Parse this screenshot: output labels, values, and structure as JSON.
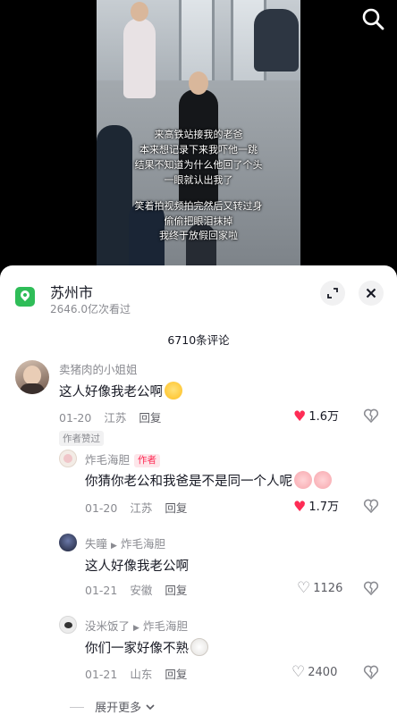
{
  "video": {
    "caption_lines": [
      "来高铁站接我的老爸",
      "本来想记录下来我吓他一跳",
      "结果不知道为什么他回了个头",
      "一眼就认出我了",
      "",
      "笑着拍视频拍完然后又转过身",
      "偷偷把眼泪抹掉",
      "我终于放假回家啦"
    ]
  },
  "location": {
    "name": "苏州市",
    "views": "2646.0亿次看过"
  },
  "comments_header": {
    "count": "6710条评论"
  },
  "comments": [
    {
      "user": "卖猪肉的小姐姐",
      "text": "这人好像我老公啊",
      "date": "01-20",
      "region": "江苏",
      "reply_label": "回复",
      "likes": "1.6万",
      "liked": true,
      "badge": "作者赞过"
    }
  ],
  "replies": [
    {
      "user": "炸毛海胆",
      "author_badge": "作者",
      "text": "你猜你老公和我爸是不是同一个人呢",
      "date": "01-20",
      "region": "江苏",
      "reply_label": "回复",
      "likes": "1.7万",
      "liked": true
    },
    {
      "user": "失瞳",
      "reply_to": "炸毛海胆",
      "text": "这人好像我老公啊",
      "date": "01-21",
      "region": "安徽",
      "reply_label": "回复",
      "likes": "1126",
      "liked": false
    },
    {
      "user": "没米饭了",
      "reply_to": "炸毛海胆",
      "text": "你们一家好像不熟",
      "date": "01-21",
      "region": "山东",
      "reply_label": "回复",
      "likes": "2400",
      "liked": false
    }
  ],
  "expand_more": "展开更多",
  "icons": {
    "search": "search-icon",
    "location": "location-pin-icon",
    "expand": "expand-icon",
    "close": "close-icon",
    "heart": "heart-icon",
    "dislike": "dislike-icon",
    "chevron": "chevron-down-icon"
  },
  "colors": {
    "accent_red": "#fe2c55",
    "location_green": "#2fbd58",
    "text_primary": "#161823",
    "text_secondary": "#8a8b91"
  }
}
